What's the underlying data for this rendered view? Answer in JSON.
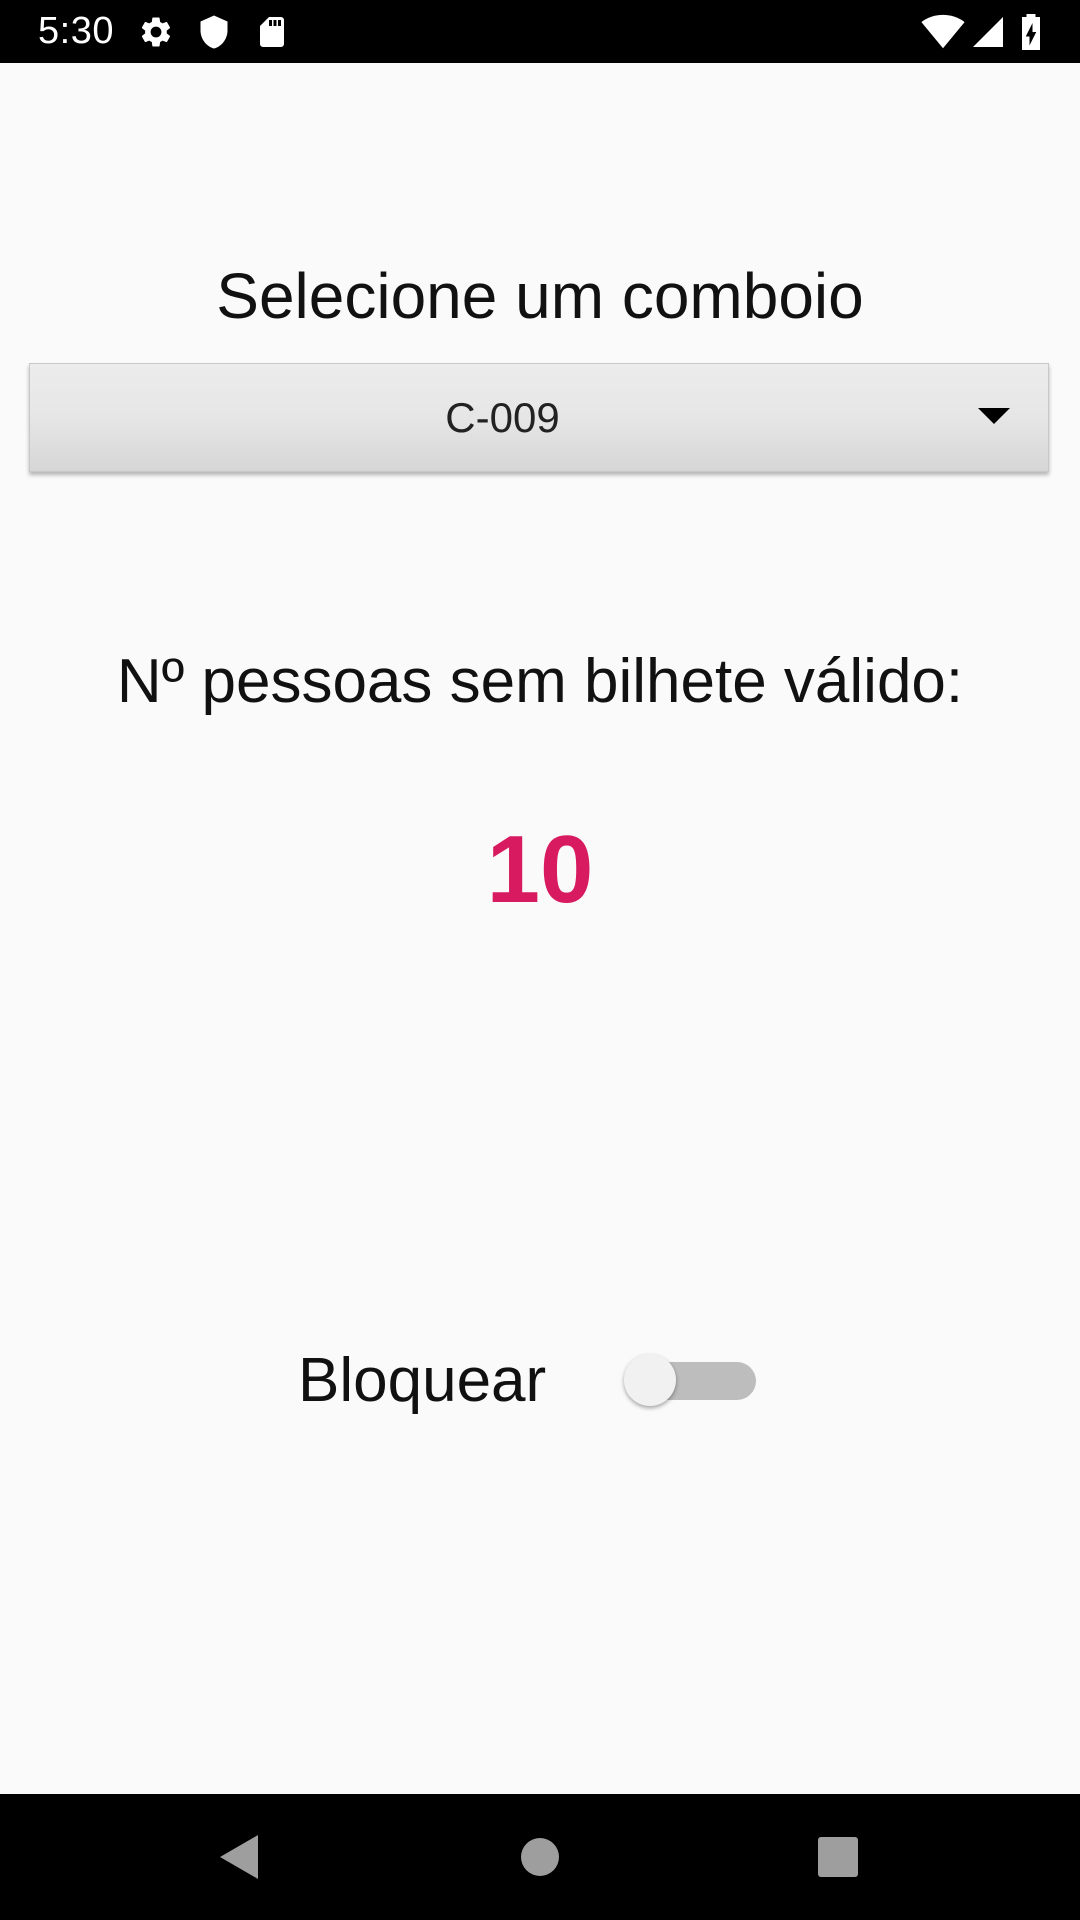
{
  "status_bar": {
    "time": "5:30",
    "left_icons": [
      "gear-icon",
      "shield-icon",
      "sd-card-icon"
    ],
    "right_icons": [
      "wifi-icon",
      "cell-signal-icon",
      "battery-charging-icon"
    ]
  },
  "main": {
    "title": "Selecione um comboio",
    "train_select": {
      "selected_value": "C-009"
    },
    "people_label": "Nº pessoas sem bilhete válido:",
    "people_count": "10",
    "block_label": "Bloquear",
    "block_switch_on": false
  },
  "nav_bar": {
    "buttons": [
      "back-icon",
      "home-icon",
      "recents-icon"
    ]
  },
  "colors": {
    "accent": "#d81b60",
    "background": "#fafafa",
    "bars": "#000000"
  }
}
